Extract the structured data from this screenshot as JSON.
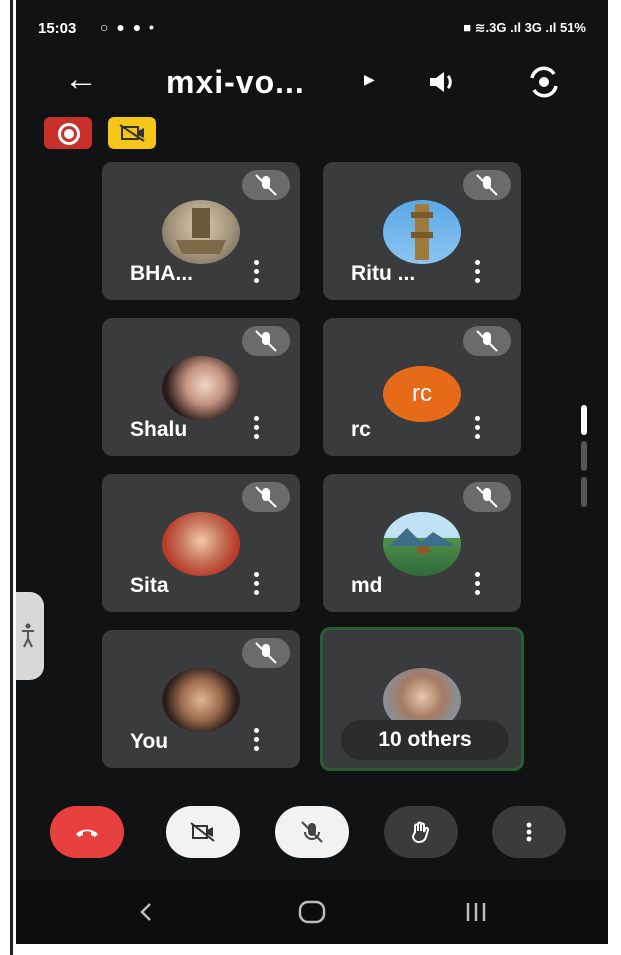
{
  "status_bar": {
    "time": "15:03",
    "left_icons": "○ ● ● •",
    "right": "■ ≋.3G .ıl 3G .ıl 51%"
  },
  "header": {
    "title": "mxi-vo...",
    "back_icon": "arrow-left-icon",
    "speaker_icon": "speaker-icon",
    "camera_switch_icon": "camera-switch-icon"
  },
  "participants": [
    {
      "name": "BHA...",
      "avatar": "emblem"
    },
    {
      "name": "Ritu ...",
      "avatar": "tower"
    },
    {
      "name": "Shalu",
      "avatar": "photo-woman"
    },
    {
      "name": "rc",
      "avatar": "initials",
      "initials": "rc"
    },
    {
      "name": "Sita",
      "avatar": "photo-woman-2"
    },
    {
      "name": "md",
      "avatar": "landscape"
    },
    {
      "name": "You",
      "avatar": "photo-woman-3"
    }
  ],
  "others_label": "10 others",
  "colors": {
    "background": "#111213",
    "tile": "#3a3b3d",
    "end_call": "#e7403e",
    "rec_badge": "#c9302c",
    "cam_badge": "#f5c518",
    "initials_bg": "#e66a17",
    "active_border": "#2b5c33"
  }
}
